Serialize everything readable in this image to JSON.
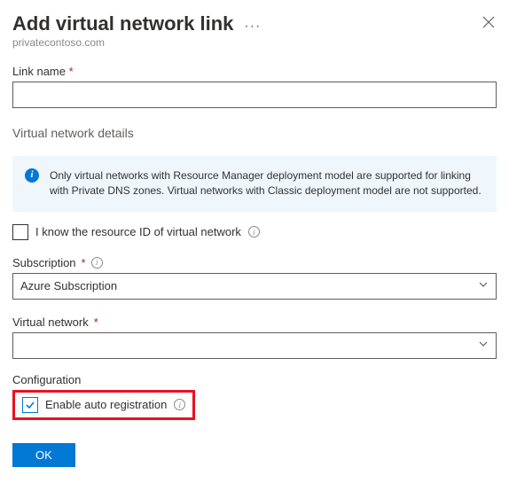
{
  "header": {
    "title": "Add virtual network link",
    "subtitle": "privatecontoso.com"
  },
  "fields": {
    "linkName": {
      "label": "Link name",
      "value": ""
    },
    "vnetDetailsHeading": "Virtual network details",
    "infoBanner": "Only virtual networks with Resource Manager deployment model are supported for linking with Private DNS zones. Virtual networks with Classic deployment model are not supported.",
    "knowResourceId": {
      "label": "I know the resource ID of virtual network",
      "checked": false
    },
    "subscription": {
      "label": "Subscription",
      "value": "Azure Subscription"
    },
    "virtualNetwork": {
      "label": "Virtual network",
      "value": ""
    },
    "configurationHeading": "Configuration",
    "autoRegistration": {
      "label": "Enable auto registration",
      "checked": true
    }
  },
  "buttons": {
    "ok": "OK"
  }
}
